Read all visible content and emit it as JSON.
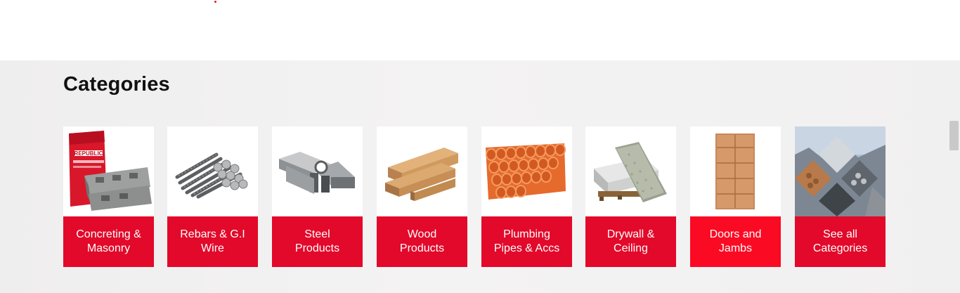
{
  "section": {
    "title": "Categories"
  },
  "categories": [
    {
      "line1": "Concreting &",
      "line2": "Masonry",
      "icon": "cement-bag-and-hollow-block-icon",
      "bag_brand": "REPUBLIC"
    },
    {
      "line1": "Rebars & G.I",
      "line2": "Wire",
      "icon": "rebar-bundle-icon"
    },
    {
      "line1": "Steel",
      "line2": "Products",
      "icon": "steel-beams-icon"
    },
    {
      "line1": "Wood",
      "line2": "Products",
      "icon": "lumber-stack-icon"
    },
    {
      "line1": "Plumbing",
      "line2": "Pipes & Accs",
      "icon": "pvc-pipes-icon"
    },
    {
      "line1": "Drywall &",
      "line2": "Ceiling",
      "icon": "drywall-boards-icon"
    },
    {
      "line1": "Doors and",
      "line2": "Jambs",
      "icon": "wooden-door-icon"
    },
    {
      "line1": "See all",
      "line2": "Categories",
      "icon": "materials-collage-icon"
    }
  ],
  "colors": {
    "card_label_bg": "#e2092a",
    "card_label_highlight_bg": "#fb0a24",
    "heading": "#111111"
  }
}
